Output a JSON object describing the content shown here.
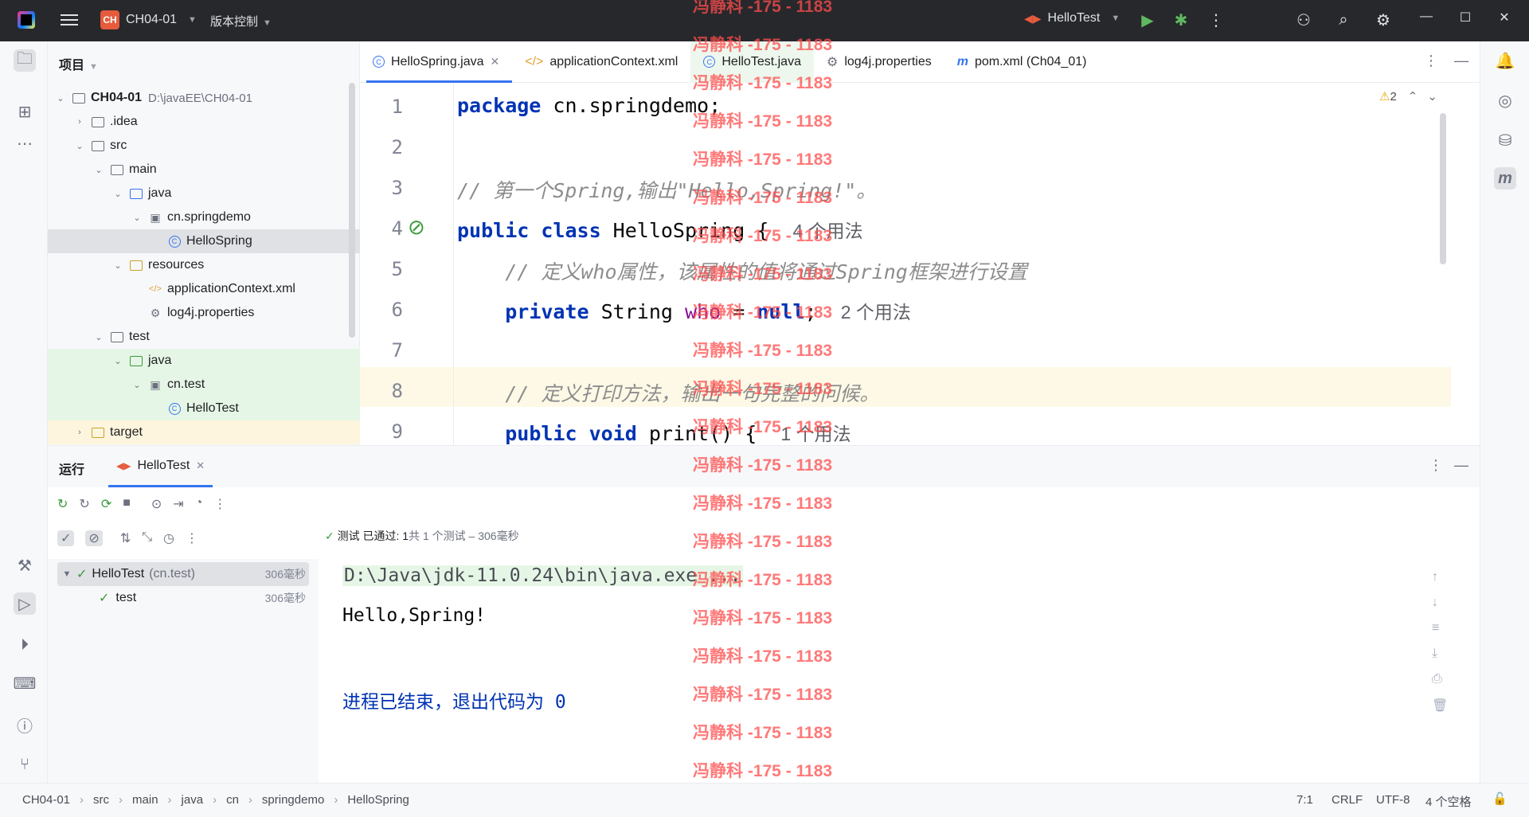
{
  "titlebar": {
    "project_badge": "CH",
    "project_name": "CH04-01",
    "vcs_label": "版本控制",
    "run_config": "HelloTest"
  },
  "project_panel": {
    "header": "项目",
    "tree": [
      {
        "label": "CH04-01",
        "path": "D:\\javaEE\\CH04-01",
        "depth": 0,
        "type": "module",
        "expanded": true
      },
      {
        "label": ".idea",
        "depth": 1,
        "type": "folder",
        "expanded": false
      },
      {
        "label": "src",
        "depth": 1,
        "type": "folder",
        "expanded": true
      },
      {
        "label": "main",
        "depth": 2,
        "type": "folder",
        "expanded": true
      },
      {
        "label": "java",
        "depth": 3,
        "type": "folder-blue",
        "expanded": true
      },
      {
        "label": "cn.springdemo",
        "depth": 4,
        "type": "package",
        "expanded": true
      },
      {
        "label": "HelloSpring",
        "depth": 5,
        "type": "class",
        "selected": true
      },
      {
        "label": "resources",
        "depth": 3,
        "type": "folder-res",
        "expanded": true
      },
      {
        "label": "applicationContext.xml",
        "depth": 4,
        "type": "xml"
      },
      {
        "label": "log4j.properties",
        "depth": 4,
        "type": "properties"
      },
      {
        "label": "test",
        "depth": 2,
        "type": "folder",
        "expanded": true
      },
      {
        "label": "java",
        "depth": 3,
        "type": "folder-green",
        "expanded": true
      },
      {
        "label": "cn.test",
        "depth": 4,
        "type": "package",
        "expanded": true
      },
      {
        "label": "HelloTest",
        "depth": 5,
        "type": "class"
      },
      {
        "label": "target",
        "depth": 1,
        "type": "folder-yellow",
        "expanded": false
      }
    ]
  },
  "editor": {
    "tabs": [
      {
        "label": "HelloSpring.java",
        "active": true,
        "closable": true
      },
      {
        "label": "applicationContext.xml"
      },
      {
        "label": "HelloTest.java"
      },
      {
        "label": "log4j.properties"
      },
      {
        "label": "pom.xml (Ch04_01)"
      }
    ],
    "warnings": "2",
    "line_numbers": [
      "1",
      "2",
      "3",
      "4",
      "5",
      "6",
      "7",
      "8",
      "9"
    ],
    "lines": {
      "l1_kw": "package",
      "l1_rest": " cn.springdemo;",
      "l3": "// 第一个Spring,输出\"Hello,Spring!\"。",
      "l4_kw": "public class",
      "l4_rest": " HelloSpring {",
      "l4_hint": "4 个用法",
      "l5": "// 定义who属性，该属性的值将通过Spring框架进行设置",
      "l6_kw": "private",
      "l6_type": " String ",
      "l6_field": "who",
      "l6_eq": " = ",
      "l6_null": "null",
      "l6_semi": ";",
      "l6_hint": "2 个用法",
      "l8": "// 定义打印方法，输出一句完整的问候。",
      "l9_kw": "public void",
      "l9_rest": " print() {",
      "l9_hint": "1 个用法"
    }
  },
  "run_panel": {
    "title": "运行",
    "tab": "HelloTest",
    "status_prefix": "测试 已通过: ",
    "status_count": "1",
    "status_rest": "共 1 个测试 – 306毫秒",
    "tree": [
      {
        "label": "HelloTest",
        "pkg": "(cn.test)",
        "duration": "306毫秒"
      },
      {
        "label": "test",
        "duration": "306毫秒"
      }
    ],
    "console": {
      "line1": "D:\\Java\\jdk-11.0.24\\bin\\java.exe ...",
      "line2": "Hello,Spring!",
      "line4": "进程已结束，退出代码为 0"
    }
  },
  "statusbar": {
    "breadcrumb": [
      "CH04-01",
      "src",
      "main",
      "java",
      "cn",
      "springdemo",
      "HelloSpring"
    ],
    "position": "7:1",
    "line_sep": "CRLF",
    "encoding": "UTF-8",
    "indent": "4 个空格"
  },
  "watermark": "冯静科 -175 - 1183",
  "colors": {
    "accent": "#3574f0",
    "keyword": "#0033b3",
    "comment": "#8c8c8c",
    "field": "#871094",
    "pass": "#3a9a3a",
    "watermark": "#ff4d4d"
  }
}
